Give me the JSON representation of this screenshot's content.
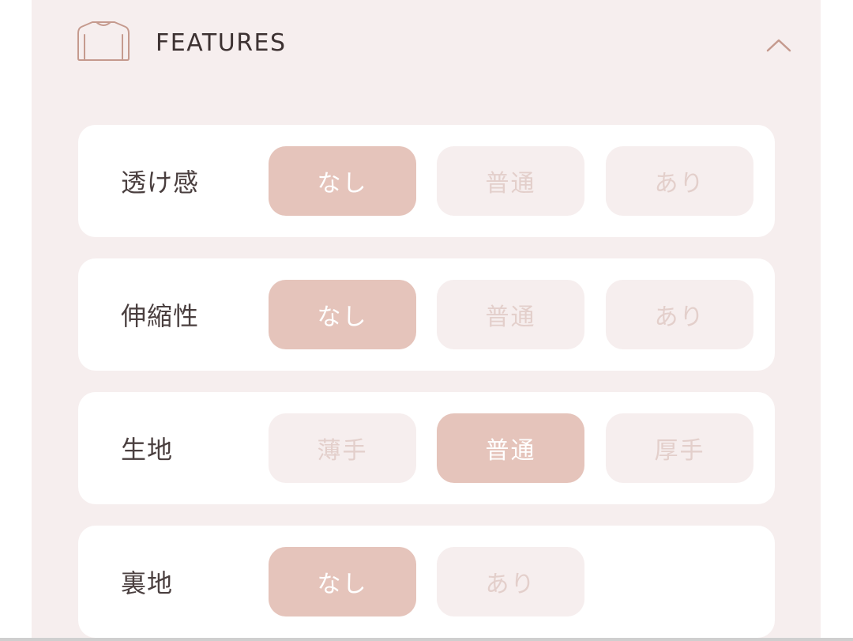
{
  "section": {
    "title": "FEATURES",
    "icon": "shirt-icon",
    "toggle_icon": "chevron-up-icon",
    "accent_color": "#e5c4bb",
    "panel_color": "#f6eeee"
  },
  "rows": [
    {
      "label": "透け感",
      "options": [
        {
          "label": "なし",
          "selected": true
        },
        {
          "label": "普通",
          "selected": false
        },
        {
          "label": "あり",
          "selected": false
        }
      ]
    },
    {
      "label": "伸縮性",
      "options": [
        {
          "label": "なし",
          "selected": true
        },
        {
          "label": "普通",
          "selected": false
        },
        {
          "label": "あり",
          "selected": false
        }
      ]
    },
    {
      "label": "生地",
      "options": [
        {
          "label": "薄手",
          "selected": false
        },
        {
          "label": "普通",
          "selected": true
        },
        {
          "label": "厚手",
          "selected": false
        }
      ]
    },
    {
      "label": "裏地",
      "options": [
        {
          "label": "なし",
          "selected": true
        },
        {
          "label": "あり",
          "selected": false
        }
      ]
    }
  ]
}
